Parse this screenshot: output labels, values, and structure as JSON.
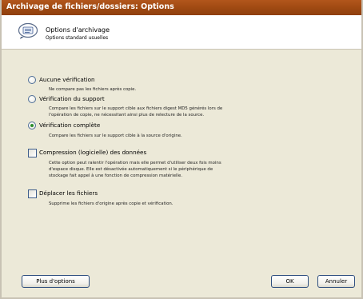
{
  "window": {
    "title": "Archivage de fichiers/dossiers: Options"
  },
  "header": {
    "title": "Options d'archivage",
    "subtitle": "Options standard usuelles"
  },
  "options": {
    "aucune": {
      "label": "Aucune vérification",
      "description": [
        "Ne compare pas les fichiers après copie."
      ],
      "selected": false
    },
    "support": {
      "label": "Vérification du support",
      "description": [
        "Compare les fichiers sur le support cible aux fichiers digest MD5 générés lors de",
        "l'opération de copie, ne nécessitant ainsi plus de relecture de la source."
      ],
      "selected": false
    },
    "complete": {
      "label": "Vérification complète",
      "description": [
        "Compare les fichiers sur le support cible à la source d'origine."
      ],
      "selected": true
    },
    "compression": {
      "label": "Compression (logicielle) des données",
      "description": [
        "Cette option peut ralentir l'opération mais elle permet d'utiliser deux fois moins",
        "d'espace disque. Elle est désactivée automatiquement si le périphérique de",
        "stockage fait appel à une fonction de compression matérielle."
      ],
      "checked": false
    },
    "deplacer": {
      "label": "Déplacer les fichiers",
      "description": [
        "Supprime les fichiers d'origine après copie et vérification."
      ],
      "checked": false
    }
  },
  "buttons": {
    "more": "Plus d'options",
    "ok": "OK",
    "cancel": "Annuler"
  },
  "colors": {
    "titlebar": "#a04a12",
    "dialog_bg": "#ece9d8",
    "radio_selected": "#2c8d2e"
  }
}
